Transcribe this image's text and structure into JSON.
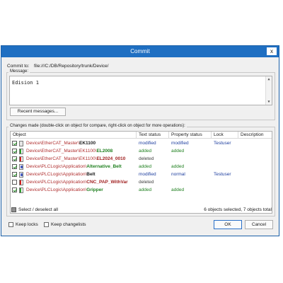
{
  "dialog": {
    "title": "Commit",
    "close_glyph": "x"
  },
  "commit_to": {
    "label": "Commit to:",
    "value": "file:///C:/DB/Repository/trunk/Device/"
  },
  "message": {
    "legend": "Message:",
    "text": "Edision 1",
    "recent_button": "Recent messages..."
  },
  "changes": {
    "legend": "Changes made (double-click on object for compare, right-click on object for more operations):",
    "columns": [
      "Object",
      "Text status",
      "Property status",
      "Lock",
      "Description"
    ],
    "rows": [
      {
        "checked": true,
        "icon": "device-file-icon",
        "path": "Device\\EtherCAT_Master\\",
        "name": "EK1100",
        "name_color": "#1a1a1a",
        "text_status": "modified",
        "property_status": "modified",
        "lock": "Testuser"
      },
      {
        "checked": true,
        "icon": "added-file-icon",
        "path": "Device\\EtherCAT_Master\\EK1100\\",
        "name": "EL2008",
        "name_color": "#208020",
        "text_status": "added",
        "property_status": "added",
        "lock": ""
      },
      {
        "checked": true,
        "icon": "deleted-file-icon",
        "path": "Device\\EtherCAT_Master\\EK1100\\",
        "name": "EL2024_0010",
        "name_color": "#a02020",
        "text_status": "deleted",
        "property_status": "",
        "lock": ""
      },
      {
        "checked": true,
        "icon": "program-file-icon",
        "path": "Device\\PLCLogic\\Application\\",
        "name": "Alternative_Belt",
        "name_color": "#208020",
        "text_status": "added",
        "property_status": "added",
        "lock": ""
      },
      {
        "checked": true,
        "icon": "program-file-icon",
        "path": "Device\\PLCLogic\\Application\\",
        "name": "Belt",
        "name_color": "#1a1a1a",
        "text_status": "modified",
        "property_status": "normal",
        "lock": "Testuser"
      },
      {
        "checked": false,
        "icon": "deleted-file-icon",
        "path": "Device\\PLCLogic\\Application\\",
        "name": "CNC_PAP_WithVar",
        "name_color": "#a02020",
        "text_status": "deleted",
        "property_status": "",
        "lock": ""
      },
      {
        "checked": true,
        "icon": "added-file-icon",
        "path": "Device\\PLCLogic\\Application\\",
        "name": "Gripper",
        "name_color": "#208020",
        "text_status": "added",
        "property_status": "added",
        "lock": ""
      }
    ],
    "select_all_label": "Select / deselect all",
    "summary": "6 objects selected, 7 objects total"
  },
  "footer": {
    "keep_locks": "Keep locks",
    "keep_changelists": "Keep changelists",
    "ok": "OK",
    "cancel": "Cancel"
  },
  "colors": {
    "titlebar": "#1f6fc2",
    "added": "#208020",
    "deleted_path": "#b03030",
    "modified": "#2040a0"
  }
}
